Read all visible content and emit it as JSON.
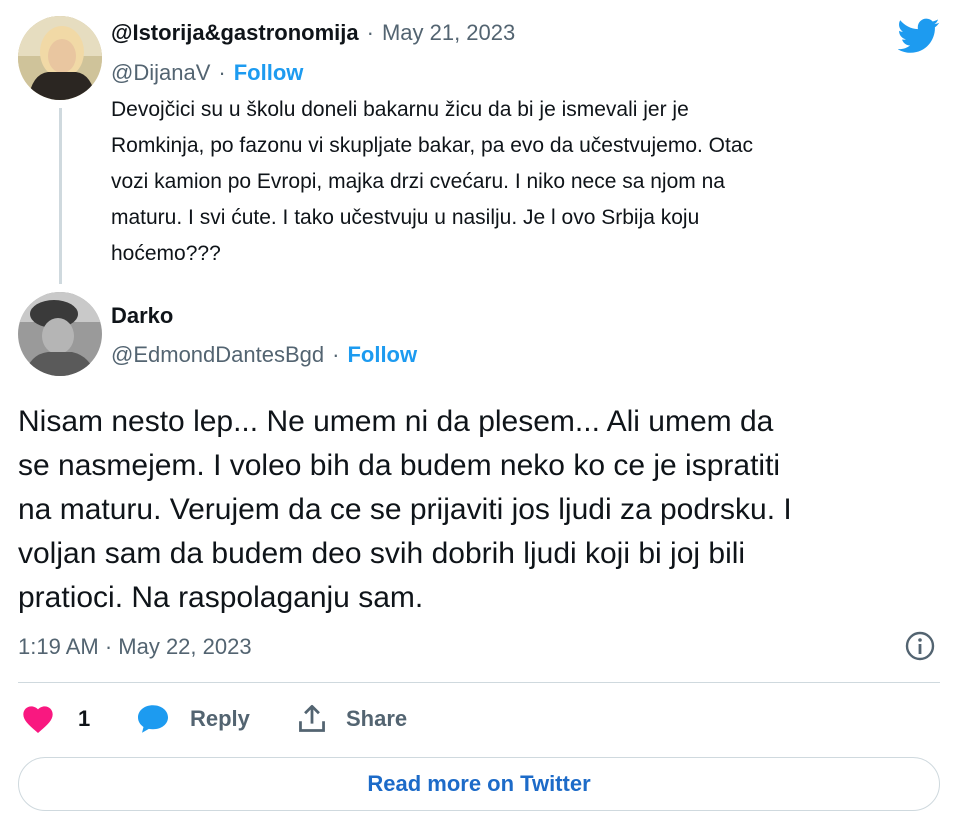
{
  "reply_tweet": {
    "display_name": "@Istorija&gastronomija",
    "date": "May 21, 2023",
    "handle": "@DijanaV",
    "follow_label": "Follow",
    "text_lines": [
      "Devojčici su u školu doneli bakarnu žicu da bi je ismevali jer je",
      "Romkinja, po fazonu vi skupljate bakar, pa evo da učestvujemo. Otac",
      "vozi kamion po Evropi, majka drzi cvećaru. I niko nece sa njom na",
      "maturu. I svi ćute. I tako učestvuju u nasilju. Je l ovo Srbija koju",
      "hoćemo???"
    ]
  },
  "main_tweet": {
    "display_name": "Darko",
    "handle": "@EdmondDantesBgd",
    "follow_label": "Follow",
    "text_lines": [
      "Nisam nesto lep... Ne umem ni da plesem... Ali umem da",
      "se nasmejem. I voleo bih da budem neko ko ce je ispratiti",
      "na maturu. Verujem da ce se prijaviti jos ljudi za podrsku. I",
      "voljan sam da budem deo svih dobrih ljudi koji bi joj bili",
      "pratioci. Na raspolaganju sam."
    ],
    "timestamp": "1:19 AM · May 22, 2023"
  },
  "actions": {
    "like_count": "1",
    "reply_label": "Reply",
    "share_label": "Share"
  },
  "read_more_label": "Read more on Twitter",
  "colors": {
    "twitter_blue": "#1d9bf0",
    "heart_pink": "#f91880",
    "text_primary": "#0f1419",
    "text_secondary": "#536471",
    "border": "#cfd9de"
  },
  "icons": [
    "twitter-bird-icon",
    "info-icon",
    "heart-icon",
    "reply-bubble-icon",
    "share-icon"
  ]
}
